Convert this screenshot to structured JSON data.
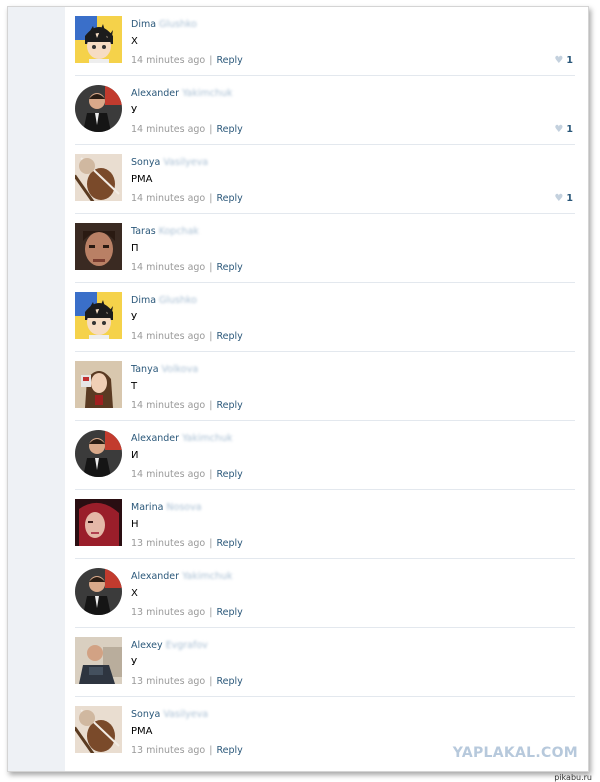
{
  "comments": [
    {
      "first_name": "Dima",
      "last_name": "Glushko",
      "text": "X",
      "time": "14 minutes ago",
      "reply": "Reply",
      "likes": "1",
      "avatar": "anime-avatar"
    },
    {
      "first_name": "Alexander",
      "last_name": "Yakimchuk",
      "text": "У",
      "time": "14 minutes ago",
      "reply": "Reply",
      "likes": "1",
      "avatar": "man-suit-avatar"
    },
    {
      "first_name": "Sonya",
      "last_name": "Vasilyeva",
      "text": "РМА",
      "time": "14 minutes ago",
      "reply": "Reply",
      "likes": "1",
      "avatar": "violin-avatar"
    },
    {
      "first_name": "Taras",
      "last_name": "Kopchak",
      "text": "П",
      "time": "14 minutes ago",
      "reply": "Reply",
      "likes": "",
      "avatar": "face-avatar"
    },
    {
      "first_name": "Dima",
      "last_name": "Glushko",
      "text": "У",
      "time": "14 minutes ago",
      "reply": "Reply",
      "likes": "",
      "avatar": "anime-avatar"
    },
    {
      "first_name": "Tanya",
      "last_name": "Volkova",
      "text": "Т",
      "time": "14 minutes ago",
      "reply": "Reply",
      "likes": "",
      "avatar": "girl-avatar"
    },
    {
      "first_name": "Alexander",
      "last_name": "Yakimchuk",
      "text": "И",
      "time": "14 minutes ago",
      "reply": "Reply",
      "likes": "",
      "avatar": "man-suit-avatar"
    },
    {
      "first_name": "Marina",
      "last_name": "Nosova",
      "text": "Н",
      "time": "13 minutes ago",
      "reply": "Reply",
      "likes": "",
      "avatar": "redhair-avatar"
    },
    {
      "first_name": "Alexander",
      "last_name": "Yakimchuk",
      "text": "Х",
      "time": "13 minutes ago",
      "reply": "Reply",
      "likes": "",
      "avatar": "man-suit-avatar"
    },
    {
      "first_name": "Alexey",
      "last_name": "Evgrafov",
      "text": "У",
      "time": "13 minutes ago",
      "reply": "Reply",
      "likes": "",
      "avatar": "man-chair-avatar"
    },
    {
      "first_name": "Sonya",
      "last_name": "Vasilyeva",
      "text": "РМА",
      "time": "13 minutes ago",
      "reply": "Reply",
      "likes": "",
      "avatar": "violin-avatar"
    }
  ],
  "watermark": "YAPLAKAL.COM",
  "corner_label": "pikabu.ru",
  "colors": {
    "link": "#2b587a",
    "meta": "#999999",
    "divider": "#e3e8ee",
    "sidebar": "#eef1f5"
  }
}
